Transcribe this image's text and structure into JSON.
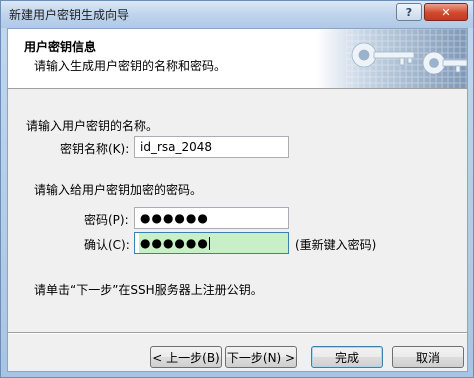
{
  "window": {
    "title": "新建用户密钥生成向导",
    "help_label": "?",
    "close_label": "✕"
  },
  "header": {
    "title": "用户密钥信息",
    "subtitle": "请输入生成用户密钥的名称和密码。"
  },
  "name_section": {
    "instruction": "请输入用户密钥的名称。",
    "label": "密钥名称(K):",
    "value": "id_rsa_2048"
  },
  "password_section": {
    "instruction": "请输入给用户密钥加密的密码。",
    "password_label": "密码(P):",
    "password_mask": "●●●●●●",
    "confirm_label": "确认(C):",
    "confirm_mask": "●●●●●●",
    "confirm_hint": "(重新键入密码)"
  },
  "footer_note": "请单击“下一步”在SSH服务器上注册公钥。",
  "buttons": {
    "back": "< 上一步(B)",
    "next": "下一步(N) >",
    "finish": "完成",
    "cancel": "取消"
  },
  "colors": {
    "title_bar": "#bfd4ec",
    "dialog_bg": "#f0f0f0",
    "close_button": "#d1492e",
    "confirm_field_bg": "#c8f0c8"
  }
}
